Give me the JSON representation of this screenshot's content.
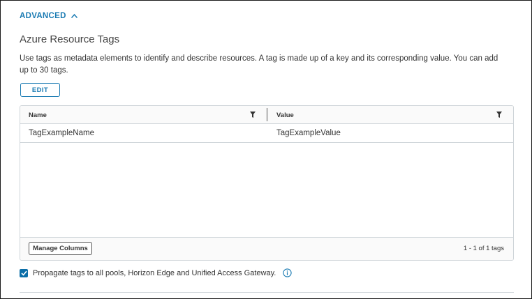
{
  "advanced": {
    "label": "ADVANCED",
    "icon": "chevron-up-icon",
    "expanded": true
  },
  "section": {
    "title": "Azure Resource Tags",
    "description": "Use tags as metadata elements to identify and describe resources. A tag is made up of a key and its corresponding value. You can add up to 30 tags."
  },
  "edit_button": {
    "label": "EDIT"
  },
  "grid": {
    "columns": [
      {
        "label": "Name",
        "icon": "filter-icon"
      },
      {
        "label": "Value",
        "icon": "filter-icon"
      }
    ],
    "rows": [
      {
        "name": "TagExampleName",
        "value": "TagExampleValue"
      }
    ],
    "footer": {
      "manage_columns_label": "Manage Columns",
      "pagination": "1 - 1 of 1 tags"
    }
  },
  "propagate": {
    "checked": true,
    "label": "Propagate tags to all pools, Horizon Edge and Unified Access Gateway.",
    "info_icon": "info-icon"
  },
  "colors": {
    "accent": "#1b7bb3",
    "checkbox": "#0b6ea8",
    "border": "#cfd5d9",
    "text": "#333333"
  }
}
